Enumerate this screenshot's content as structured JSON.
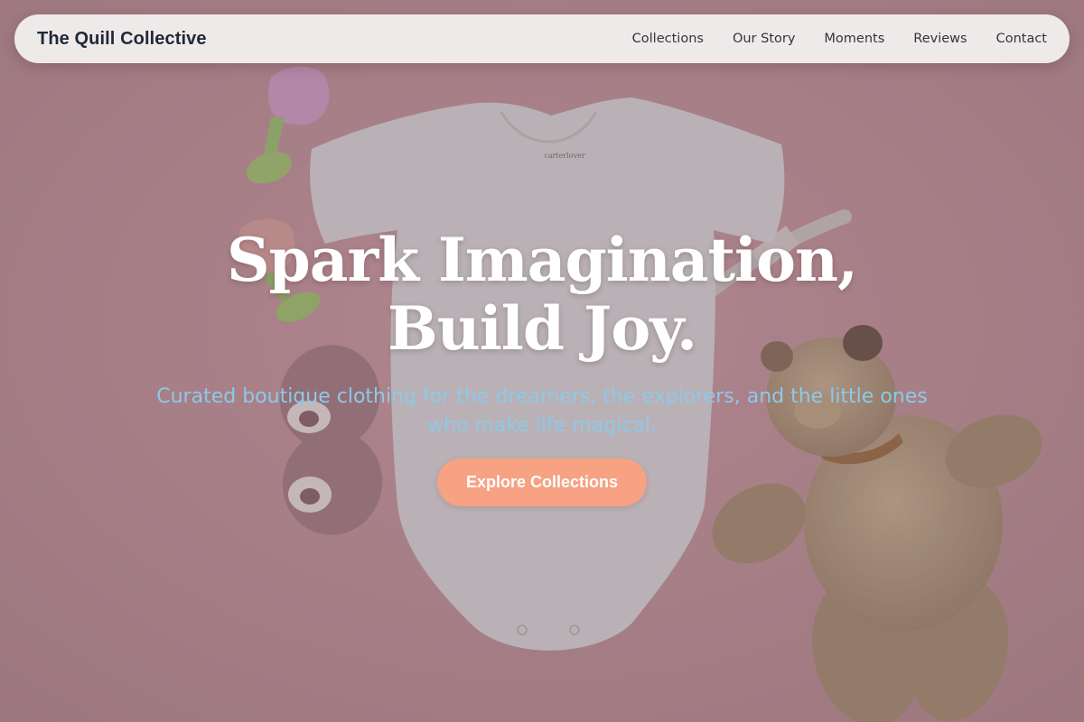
{
  "nav": {
    "brand": "The Quill Collective",
    "links": [
      "Collections",
      "Our Story",
      "Moments",
      "Reviews",
      "Contact"
    ]
  },
  "hero": {
    "title": "Spark Imagination, Build Joy.",
    "subtitle": "Curated boutique clothing for the dreamers, the explorers, and the little ones who make life magical.",
    "cta": "Explore Collections",
    "onesie_label": "carterlover"
  },
  "colors": {
    "background": "#d9a3a8",
    "nav_background": "#efeaea",
    "brand_text": "#1f2937",
    "title_text": "#ffffff",
    "subtitle_text": "#8ec9e8",
    "cta_background": "#f6a283",
    "cta_text": "#ffffff"
  }
}
